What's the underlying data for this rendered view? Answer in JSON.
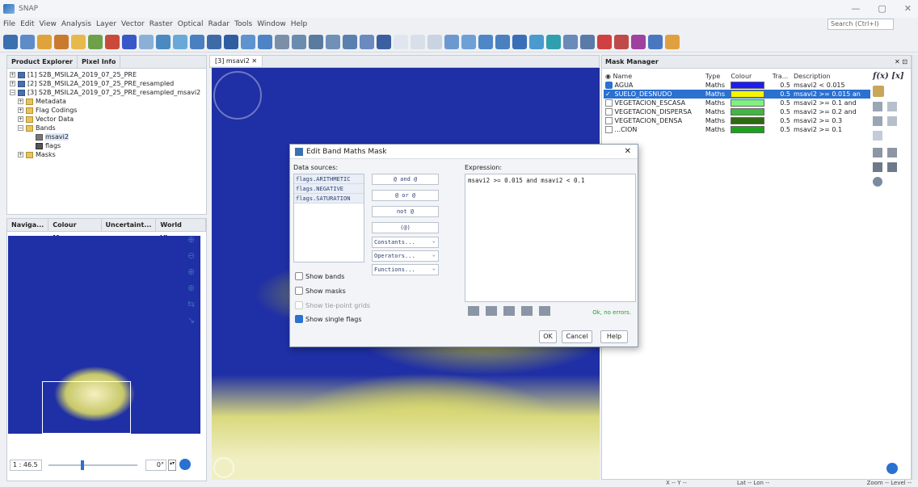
{
  "app": {
    "title": "SNAP",
    "search_placeholder": "Search (Ctrl+I)"
  },
  "menu": [
    "File",
    "Edit",
    "View",
    "Analysis",
    "Layer",
    "Vector",
    "Raster",
    "Optical",
    "Radar",
    "Tools",
    "Window",
    "Help"
  ],
  "product_explorer": {
    "tabs": [
      "Product Explorer",
      "Pixel Info"
    ],
    "tree": [
      {
        "label": "[1] S2B_MSIL2A_2019_07_25_PRE"
      },
      {
        "label": "[2] S2B_MSIL2A_2019_07_25_PRE_resampled"
      },
      {
        "label": "[3] S2B_MSIL2A_2019_07_25_PRE_resampled_msavi2"
      },
      {
        "label": "Metadata"
      },
      {
        "label": "Flag Codings"
      },
      {
        "label": "Vector Data"
      },
      {
        "label": "Bands"
      },
      {
        "label": "msavi2"
      },
      {
        "label": "flags"
      },
      {
        "label": "Masks"
      }
    ]
  },
  "navigation": {
    "tabs": [
      "Naviga...",
      "Colour Ma...",
      "Uncertaint...",
      "World View"
    ],
    "scale": "1 : 46.5",
    "rotation": "0°"
  },
  "image_view": {
    "tab": "[3] msavi2"
  },
  "mask_manager": {
    "title": "Mask Manager",
    "columns": [
      "Name",
      "Type",
      "Colour",
      "Tra...",
      "Description"
    ],
    "rows": [
      {
        "checked": true,
        "name": "AGUA",
        "type": "Maths",
        "color": "#1d1df0",
        "transparency": "0.5",
        "description": "msavi2 < 0.015",
        "selected": false
      },
      {
        "checked": true,
        "name": "SUELO_DESNUDO",
        "type": "Maths",
        "color": "#f5f500",
        "transparency": "0.5",
        "description": "msavi2 >= 0.015 an",
        "selected": true
      },
      {
        "checked": false,
        "name": "VEGETACION_ESCASA",
        "type": "Maths",
        "color": "#7ef27e",
        "transparency": "0.5",
        "description": "msavi2 >= 0.1 and",
        "selected": false
      },
      {
        "checked": false,
        "name": "VEGETACION_DISPERSA",
        "type": "Maths",
        "color": "#41b641",
        "transparency": "0.5",
        "description": "msavi2 >= 0.2 and",
        "selected": false
      },
      {
        "checked": false,
        "name": "VEGETACION_DENSA",
        "type": "Maths",
        "color": "#2e6a10",
        "transparency": "0.5",
        "description": "msavi2 >= 0.3",
        "selected": false
      },
      {
        "checked": false,
        "name": "...CION",
        "type": "Maths",
        "color": "#1aa21a",
        "transparency": "0.5",
        "description": "msavi2 >= 0.1",
        "selected": false
      }
    ],
    "fx_label": "f(x)",
    "x_label": "[x]"
  },
  "dialog": {
    "title": "Edit Band Maths Mask",
    "data_sources_label": "Data sources:",
    "data_sources": [
      "flags.ARITHMETIC",
      "flags.NEGATIVE",
      "flags.SATURATION"
    ],
    "operator_buttons": [
      "@ and @",
      "@ or @",
      "not @",
      "(@)"
    ],
    "dropdowns": [
      "Constants...",
      "Operators...",
      "Functions..."
    ],
    "checkboxes": [
      {
        "label": "Show bands",
        "checked": false,
        "enabled": true
      },
      {
        "label": "Show masks",
        "checked": false,
        "enabled": true
      },
      {
        "label": "Show tie-point grids",
        "checked": false,
        "enabled": false
      },
      {
        "label": "Show single flags",
        "checked": true,
        "enabled": true
      }
    ],
    "expression_label": "Expression:",
    "expression": "msavi2 >= 0.015 and msavi2 < 0.1",
    "status": "Ok, no errors.",
    "ok": "OK",
    "cancel": "Cancel",
    "help": "Help"
  },
  "statusbar": {
    "xy": "X  -- Y  --",
    "latlon": "Lat  -- Lon  --",
    "zoom": "Zoom -- Level --"
  }
}
